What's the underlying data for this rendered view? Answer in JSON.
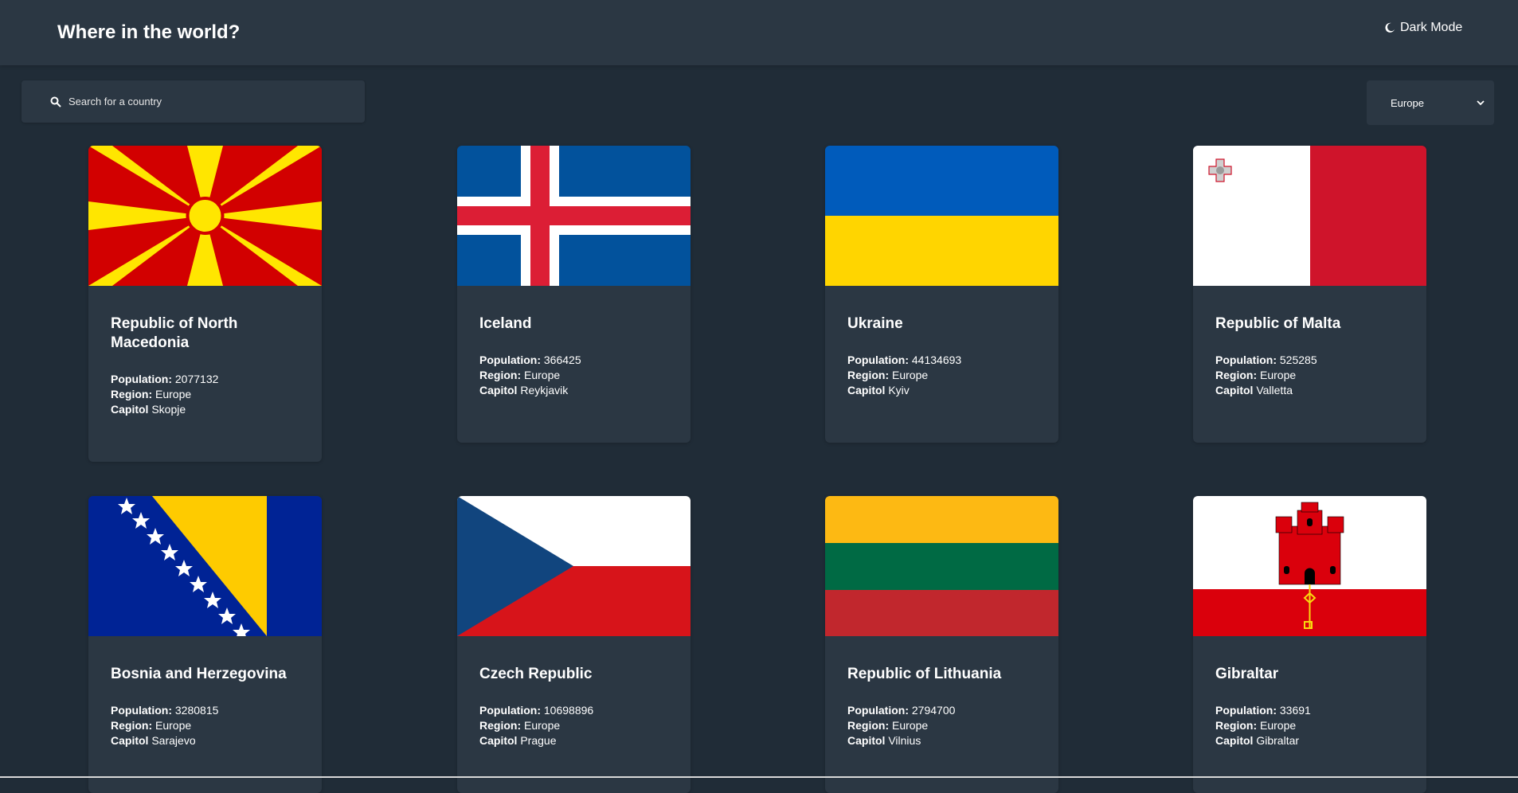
{
  "header": {
    "title": "Where in the world?",
    "mode_label": "Dark Mode"
  },
  "search": {
    "placeholder": "Search for a country",
    "value": ""
  },
  "filter": {
    "selected": "Europe"
  },
  "labels": {
    "population": "Population:",
    "region": "Region:",
    "capital": "Capitol"
  },
  "countries": [
    {
      "name": "Republic of North Macedonia",
      "population": "2077132",
      "region": "Europe",
      "capital": "Skopje",
      "flag": "north-macedonia"
    },
    {
      "name": "Iceland",
      "population": "366425",
      "region": "Europe",
      "capital": "Reykjavik",
      "flag": "iceland"
    },
    {
      "name": "Ukraine",
      "population": "44134693",
      "region": "Europe",
      "capital": "Kyiv",
      "flag": "ukraine"
    },
    {
      "name": "Republic of Malta",
      "population": "525285",
      "region": "Europe",
      "capital": "Valletta",
      "flag": "malta"
    },
    {
      "name": "Bosnia and Herzegovina",
      "population": "3280815",
      "region": "Europe",
      "capital": "Sarajevo",
      "flag": "bosnia-herzegovina"
    },
    {
      "name": "Czech Republic",
      "population": "10698896",
      "region": "Europe",
      "capital": "Prague",
      "flag": "czech-republic"
    },
    {
      "name": "Republic of Lithuania",
      "population": "2794700",
      "region": "Europe",
      "capital": "Vilnius",
      "flag": "lithuania"
    },
    {
      "name": "Gibraltar",
      "population": "33691",
      "region": "Europe",
      "capital": "Gibraltar",
      "flag": "gibraltar"
    }
  ],
  "colors": {
    "background": "#202c37",
    "element": "#2b3743",
    "text": "#ffffff"
  }
}
